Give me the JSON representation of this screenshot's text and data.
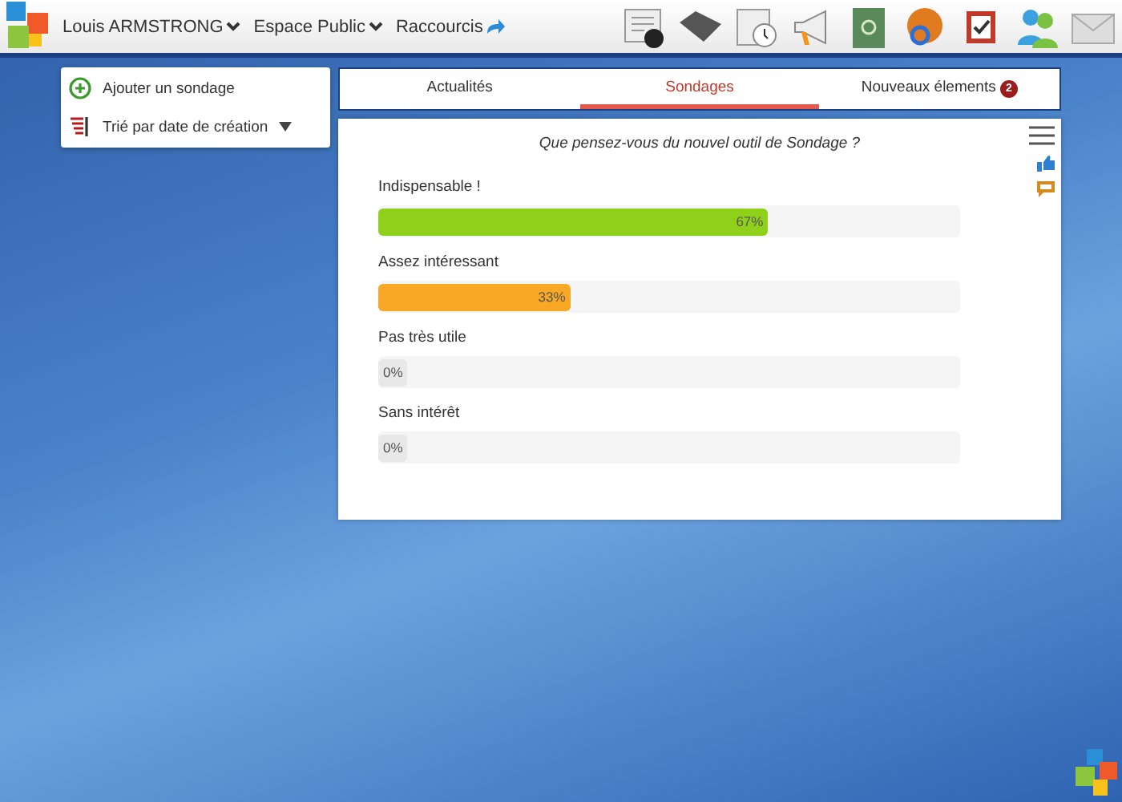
{
  "topbar": {
    "menus": [
      {
        "label": "Louis ARMSTRONG",
        "kind": "dropdown"
      },
      {
        "label": "Espace Public",
        "kind": "dropdown"
      },
      {
        "label": "Raccourcis",
        "kind": "shortcut"
      }
    ]
  },
  "sidebar": {
    "items": [
      {
        "label": "Ajouter un sondage",
        "kind": "add"
      },
      {
        "label": "Trié par date de création",
        "kind": "sort"
      }
    ]
  },
  "tabs": [
    {
      "label": "Actualités",
      "selected": false
    },
    {
      "label": "Sondages",
      "selected": true
    },
    {
      "label": "Nouveaux élements",
      "selected": false,
      "badge": "2"
    }
  ],
  "poll": {
    "question": "Que pensez-vous du nouvel outil de Sondage ?",
    "options": [
      {
        "label": "Indispensable !",
        "level": 0.67,
        "reading": "67%",
        "color": "#8fd11a"
      },
      {
        "label": "Assez intéressant",
        "level": 0.33,
        "reading": "33%",
        "color": "#f9a825"
      },
      {
        "label": "Pas très utile",
        "level": 0,
        "reading": "0%",
        "color": "#e8e8e8"
      },
      {
        "label": "Sans intérêt",
        "level": 0,
        "reading": "0%",
        "color": "#e8e8e8"
      }
    ]
  }
}
